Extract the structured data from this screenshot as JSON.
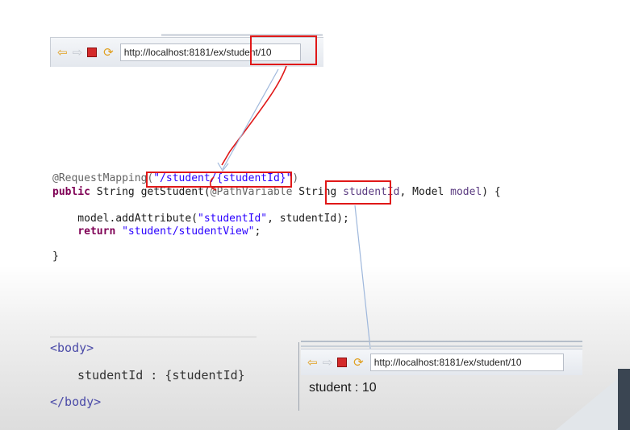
{
  "top_browser": {
    "back_icon": "back-arrow-icon",
    "forward_icon": "forward-arrow-icon",
    "stop_icon": "stop-icon",
    "refresh_icon": "refresh-icon",
    "url": "http://localhost:8181/ex/student/10"
  },
  "code": {
    "line1_annotation": "@RequestMapping(",
    "line1_path": "\"/student/{studentId}\"",
    "line1_close": ")",
    "line2_public": "public",
    "line2_sig_a": " String getStudent(",
    "line2_pathvar": "@PathVariable",
    "line2_sig_b": " String ",
    "line2_param": "studentId",
    "line2_sig_c": ", Model ",
    "line2_model": "model",
    "line2_end": ") {",
    "line3_a": "    model.addAttribute(",
    "line3_str": "\"studentId\"",
    "line3_b": ", studentId);",
    "line4_return": "return",
    "line4_str": "\"student/studentView\"",
    "line4_end": ";",
    "line5": "}"
  },
  "jsp": {
    "body_open": "<body>",
    "expr": "studentId : {studentId}",
    "body_close": "</body>"
  },
  "bottom_browser": {
    "url": "http://localhost:8181/ex/student/10",
    "output": "student : 10"
  },
  "colors": {
    "highlight": "#e01818",
    "keyword": "#7f0055",
    "string": "#2a00ff",
    "arrow": "#9fb8dc"
  }
}
